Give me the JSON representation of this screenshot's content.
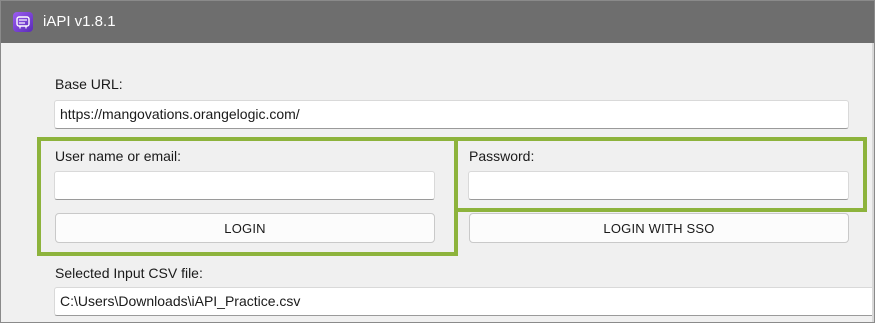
{
  "window": {
    "title": "iAPI v1.8.1",
    "icon": "iapi-app-icon",
    "title_bar_color": "#6e6e6e"
  },
  "form": {
    "base_url_label": "Base URL:",
    "base_url_value": "https://mangovations.orangelogic.com/",
    "username_label": "User name or email:",
    "username_value": "",
    "password_label": "Password:",
    "password_value": "",
    "login_button": "LOGIN",
    "login_sso_button": "LOGIN WITH SSO",
    "csv_label": "Selected Input CSV file:",
    "csv_value": "C:\\Users\\Downloads\\iAPI_Practice.csv"
  },
  "annotation": {
    "highlight_color": "#8db33c"
  }
}
